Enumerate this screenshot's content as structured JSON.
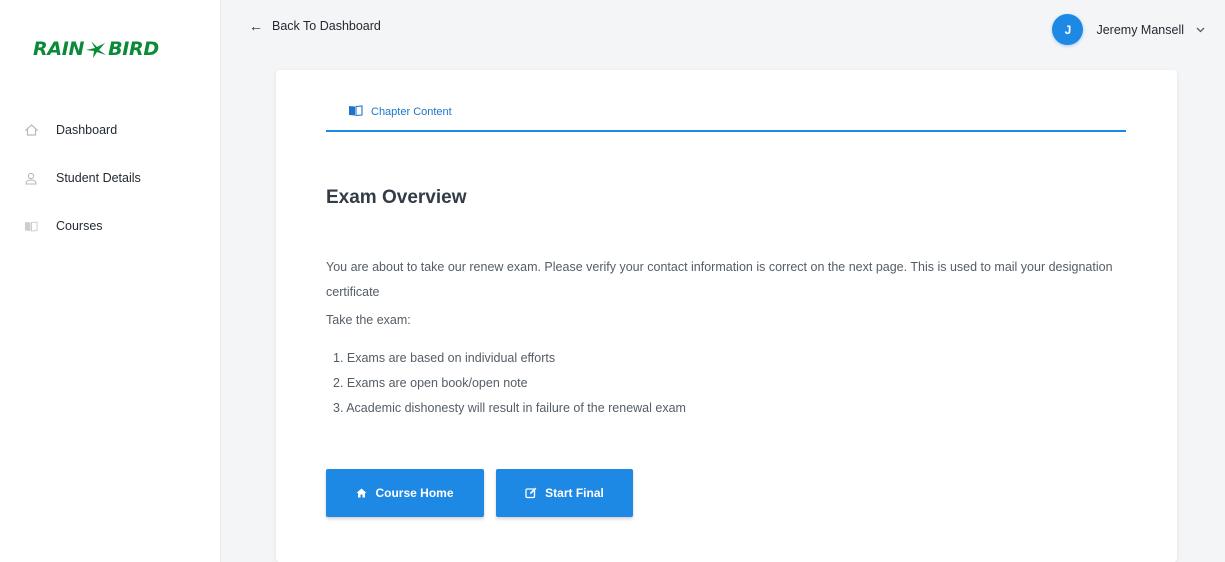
{
  "brand": {
    "logo_left": "RAIN",
    "logo_right": "BIRD",
    "color": "#0b8a3a"
  },
  "sidebar": {
    "items": [
      {
        "label": "Dashboard",
        "icon": "home-icon"
      },
      {
        "label": "Student Details",
        "icon": "user-icon"
      },
      {
        "label": "Courses",
        "icon": "book-icon"
      }
    ]
  },
  "topbar": {
    "back_label": "Back To Dashboard",
    "user": {
      "initial": "J",
      "name": "Jeremy Mansell"
    }
  },
  "tab": {
    "label": "Chapter Content",
    "icon": "book-open-icon"
  },
  "content": {
    "title": "Exam Overview",
    "intro": "You are about to take our renew exam. Please verify your contact information is correct on the next page. This is used to mail your designation certificate",
    "take_label": "Take the exam:",
    "rules": [
      "1. Exams are based on individual efforts",
      "2. Exams are open book/open note",
      "3. Academic dishonesty will result in failure of the renewal exam"
    ]
  },
  "buttons": {
    "course_home": "Course Home",
    "start_final": "Start Final"
  },
  "colors": {
    "accent": "#1e88e5",
    "background": "#f4f5f7"
  }
}
